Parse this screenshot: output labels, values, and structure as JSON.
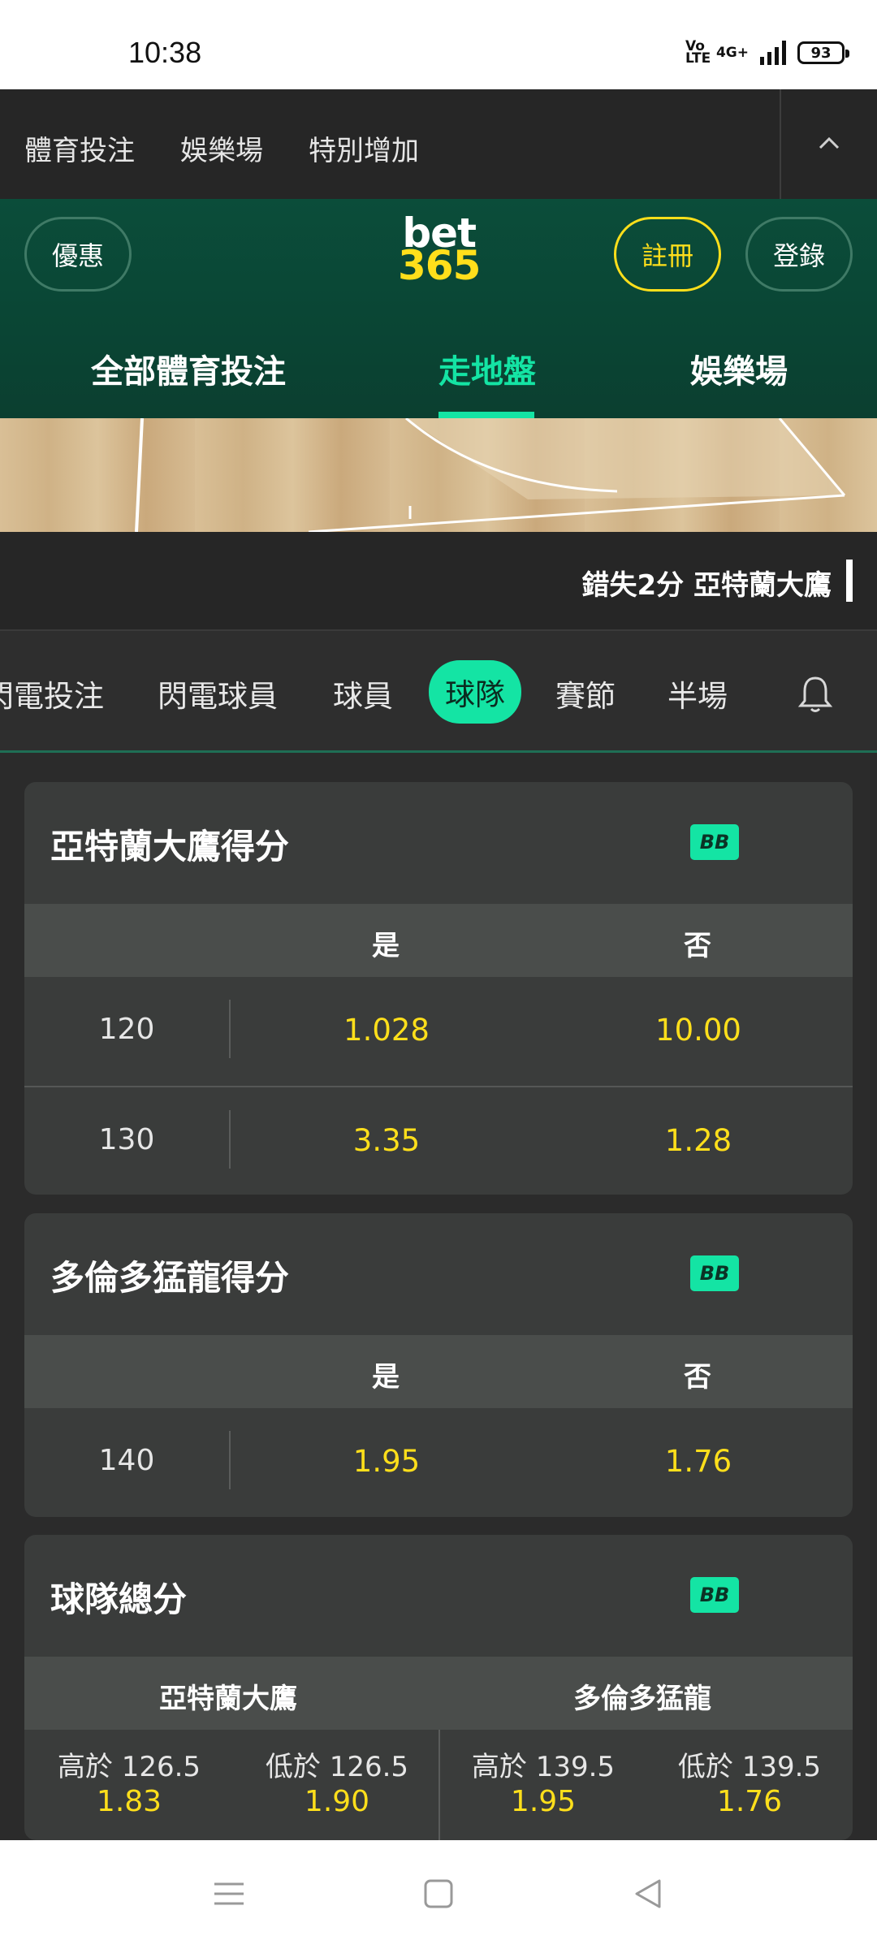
{
  "status_bar": {
    "time": "10:38",
    "volte": "Vo LTE",
    "network": "4G+",
    "battery": "93"
  },
  "top_nav": {
    "items": [
      "體育投注",
      "娛樂場",
      "特別增加"
    ]
  },
  "header": {
    "promo_label": "優惠",
    "logo_line1": "bet",
    "logo_line2": "365",
    "register_label": "註冊",
    "login_label": "登錄",
    "tabs": [
      "全部體育投注",
      "走地盤",
      "娛樂場"
    ],
    "active_tab": "走地盤"
  },
  "ticker": {
    "text": "錯失2分  亞特蘭大鷹"
  },
  "market_tabs": {
    "items": [
      "閃電投注",
      "閃電球員",
      "球員",
      "球隊",
      "賽節",
      "半場"
    ],
    "active": "球隊"
  },
  "cards": [
    {
      "title": "亞特蘭大鷹得分",
      "badge": "BB",
      "col_yes": "是",
      "col_no": "否",
      "rows": [
        {
          "line": "120",
          "yes": "1.028",
          "no": "10.00"
        },
        {
          "line": "130",
          "yes": "3.35",
          "no": "1.28"
        }
      ]
    },
    {
      "title": "多倫多猛龍得分",
      "badge": "BB",
      "col_yes": "是",
      "col_no": "否",
      "rows": [
        {
          "line": "140",
          "yes": "1.95",
          "no": "1.76"
        }
      ]
    },
    {
      "title": "球隊總分",
      "badge": "BB",
      "team1": "亞特蘭大鷹",
      "team2": "多倫多猛龍",
      "markets": [
        {
          "label": "高於 126.5",
          "odds": "1.83"
        },
        {
          "label": "低於 126.5",
          "odds": "1.90"
        },
        {
          "label": "高於 139.5",
          "odds": "1.95"
        },
        {
          "label": "低於 139.5",
          "odds": "1.76"
        }
      ]
    }
  ],
  "colors": {
    "accent": "#14e4a4",
    "odds": "#ffdf1b",
    "header_bg": "#0b4d3a"
  }
}
